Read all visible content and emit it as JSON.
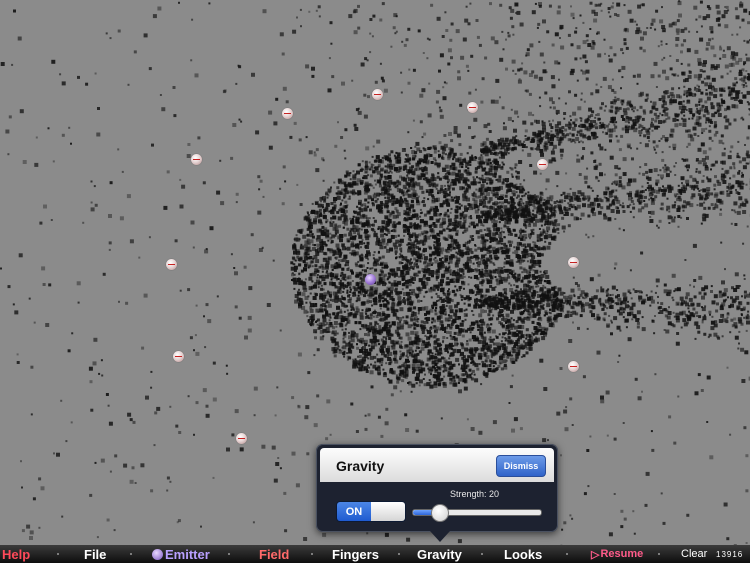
{
  "popover": {
    "title": "Gravity",
    "dismiss_label": "Dismiss",
    "strength_label": "Strength: 20",
    "toggle_label": "ON",
    "slider_value": 20,
    "slider_max": 100
  },
  "toolbar": {
    "help": "Help",
    "file": "File",
    "emitter": "Emitter",
    "field": "Field",
    "fingers": "Fingers",
    "gravity": "Gravity",
    "looks": "Looks",
    "resume": "Resume",
    "clear": "Clear",
    "particle_count": "13916"
  },
  "colors": {
    "background": "#8b8b8b",
    "particle": "#111111",
    "help": "#ff4a5a",
    "emitter": "#b9a0ff",
    "field": "#ff6a6a",
    "resume": "#ff5b8a"
  },
  "icons": {
    "emitter": "emitter-ball-icon",
    "field": "field-ball-icon",
    "resume": "play-icon"
  }
}
